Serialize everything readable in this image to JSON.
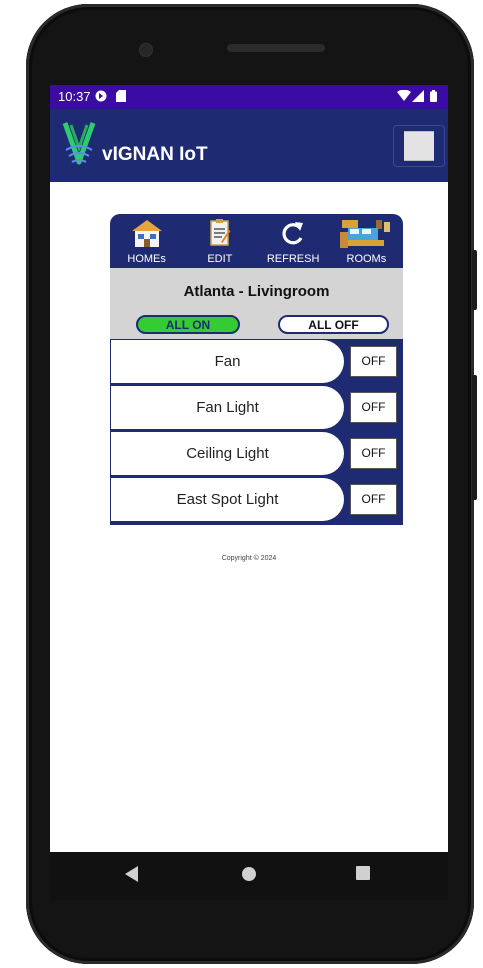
{
  "status_bar": {
    "time": "10:37"
  },
  "app": {
    "title": "vIGNAN IoT"
  },
  "toolbar": {
    "homes_label": "HOMEs",
    "edit_label": "EDIT",
    "refresh_label": "REFRESH",
    "rooms_label": "ROOMs"
  },
  "room": {
    "title": "Atlanta - Livingroom",
    "all_on_label": "ALL ON",
    "all_off_label": "ALL OFF"
  },
  "devices": [
    {
      "name": "Fan",
      "state": "OFF"
    },
    {
      "name": "Fan Light",
      "state": "OFF"
    },
    {
      "name": "Ceiling Light",
      "state": "OFF"
    },
    {
      "name": "East Spot Light",
      "state": "OFF"
    }
  ],
  "footer": {
    "copyright": "Copyright © 2024"
  },
  "colors": {
    "status_bar": "#3a0ca3",
    "app_bar": "#1e2a72",
    "all_on": "#33cc33",
    "room_header": "#d4d4d4"
  }
}
